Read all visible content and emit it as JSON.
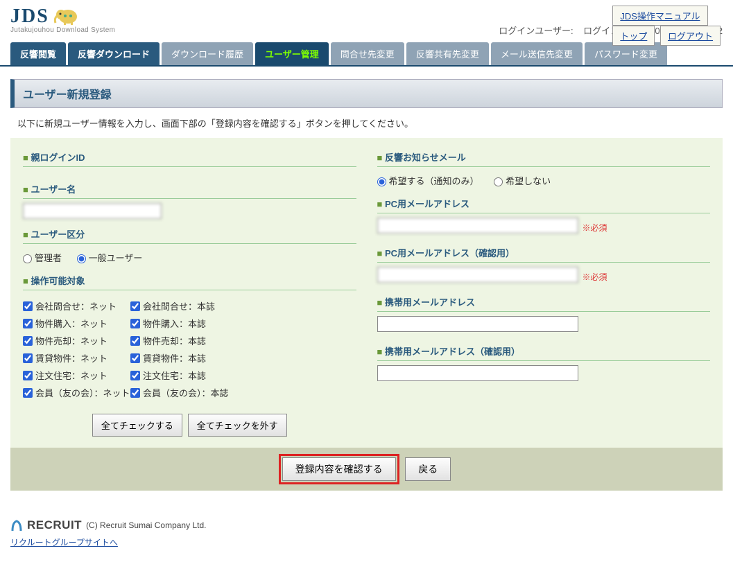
{
  "logo": {
    "text": "JDS",
    "sub": "Jutakujouhou Download System"
  },
  "top_links": {
    "manual": "JDS操作マニュアル",
    "top": "トップ",
    "logout": "ログアウト"
  },
  "login_info": {
    "user_label": "ログインユーザー:",
    "user_value": "  ",
    "time_label": "ログイン時間:",
    "time_value": "2020/03/24 14:05:42"
  },
  "nav": {
    "hankyo_etsuran": "反響閲覧",
    "hankyo_download": "反響ダウンロード",
    "download_history": "ダウンロード履歴",
    "user_manage": "ユーザー管理",
    "inquiry_change": "問合せ先変更",
    "share_change": "反響共有先変更",
    "mail_change": "メール送信先変更",
    "password_change": "パスワード変更"
  },
  "page_title": "ユーザー新規登録",
  "instruction": "以下に新規ユーザー情報を入力し、画面下部の「登録内容を確認する」ボタンを押してください。",
  "left": {
    "parent_id_label": "親ログインID",
    "parent_id_value": "  ",
    "username_label": "ユーザー名",
    "username_value": "  ",
    "user_kubun_label": "ユーザー区分",
    "kubun_admin": "管理者",
    "kubun_general": "一般ユーザー",
    "target_label": "操作可能対象",
    "checks": [
      [
        "会社問合せ：ネット",
        "会社問合せ：本誌"
      ],
      [
        "物件購入：ネット",
        "物件購入：本誌"
      ],
      [
        "物件売却：ネット",
        "物件売却：本誌"
      ],
      [
        "賃貸物件：ネット",
        "賃貸物件：本誌"
      ],
      [
        "注文住宅：ネット",
        "注文住宅：本誌"
      ],
      [
        "会員（友の会）：ネット",
        "会員（友の会）：本誌"
      ]
    ],
    "check_all": "全てチェックする",
    "uncheck_all": "全てチェックを外す"
  },
  "right": {
    "notice_label": "反響お知らせメール",
    "notice_yes": "希望する（通知のみ）",
    "notice_no": "希望しない",
    "pc_mail_label": "PC用メールアドレス",
    "pc_mail_value": "  ",
    "pc_mail_confirm_label": "PC用メールアドレス（確認用）",
    "pc_mail_confirm_value": "  ",
    "mobile_mail_label": "携帯用メールアドレス",
    "mobile_mail_confirm_label": "携帯用メールアドレス（確認用）",
    "required": "※必須"
  },
  "submit": {
    "confirm": "登録内容を確認する",
    "back": "戻る"
  },
  "footer": {
    "brand": "RECRUIT",
    "copyright": "(C) Recruit Sumai Company Ltd.",
    "link": "リクルートグループサイトへ"
  }
}
